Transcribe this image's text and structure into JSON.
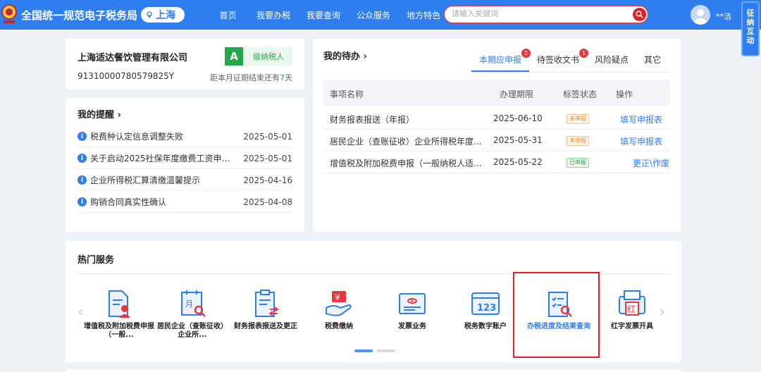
{
  "header": {
    "site_title": "全国统一规范电子税务局",
    "city": "上海",
    "nav": [
      "首页",
      "我要办税",
      "我要查询",
      "公众服务",
      "地方特色"
    ],
    "search_placeholder": "请输入关键词",
    "username": "**洁",
    "side_tab": [
      "征",
      "纳",
      "互",
      "动"
    ],
    "colors": {
      "primary": "#2f7ef0",
      "search_border": "#e0373a"
    }
  },
  "company": {
    "name": "上海适达餐饮管理有限公司",
    "tax_id": "91310000780579825Y",
    "grade_letter": "A",
    "grade_label": "级纳税人",
    "deadline_prefix": "距本月征期结束还有",
    "deadline_days": "7",
    "deadline_suffix": "天"
  },
  "reminders": {
    "title": "我的提醒",
    "items": [
      {
        "text": "税费种认定信息调整失败",
        "date": "2025-05-01"
      },
      {
        "text": "关于启动2025社保年度缴费工资申报...",
        "date": "2025-05-01"
      },
      {
        "text": "企业所得税汇算清缴温馨提示",
        "date": "2025-04-16"
      },
      {
        "text": "购销合同真实性确认",
        "date": "2025-04-08"
      }
    ]
  },
  "todo": {
    "title": "我的待办",
    "tabs": [
      {
        "label": "本期应申报",
        "badge": "2",
        "active": true
      },
      {
        "label": "待签收文书",
        "badge": "1",
        "active": false
      },
      {
        "label": "风险疑点",
        "badge": "",
        "active": false
      },
      {
        "label": "其它",
        "badge": "",
        "active": false
      }
    ],
    "columns": [
      "事项名称",
      "办理期限",
      "标签状态",
      "操作"
    ],
    "rows": [
      {
        "name": "财务报表报送（年报）",
        "deadline": "2025-06-10",
        "status": "未申报",
        "action": "填写申报表"
      },
      {
        "name": "居民企业（查账征收）企业所得税年度...",
        "deadline": "2025-05-31",
        "status": "未申报",
        "action": "填写申报表"
      },
      {
        "name": "增值税及附加税费申报（一般纳税人适...",
        "deadline": "2025-05-22",
        "status": "已申报",
        "action": "更正\\作废"
      }
    ]
  },
  "services": {
    "title": "热门服务",
    "items": [
      {
        "label": "增值税及附加税费申报（一般...",
        "icon": "vat-declaration-icon"
      },
      {
        "label": "居民企业（查账征收）企业所...",
        "icon": "enterprise-tax-icon"
      },
      {
        "label": "财务报表报送及更正",
        "icon": "financial-report-icon"
      },
      {
        "label": "税费缴纳",
        "icon": "tax-payment-icon"
      },
      {
        "label": "发票业务",
        "icon": "invoice-icon"
      },
      {
        "label": "税务数字账户",
        "icon": "digital-account-icon"
      },
      {
        "label": "办税进度及结果查询",
        "icon": "progress-query-icon"
      },
      {
        "label": "红字发票开具",
        "icon": "red-invoice-icon"
      }
    ]
  }
}
